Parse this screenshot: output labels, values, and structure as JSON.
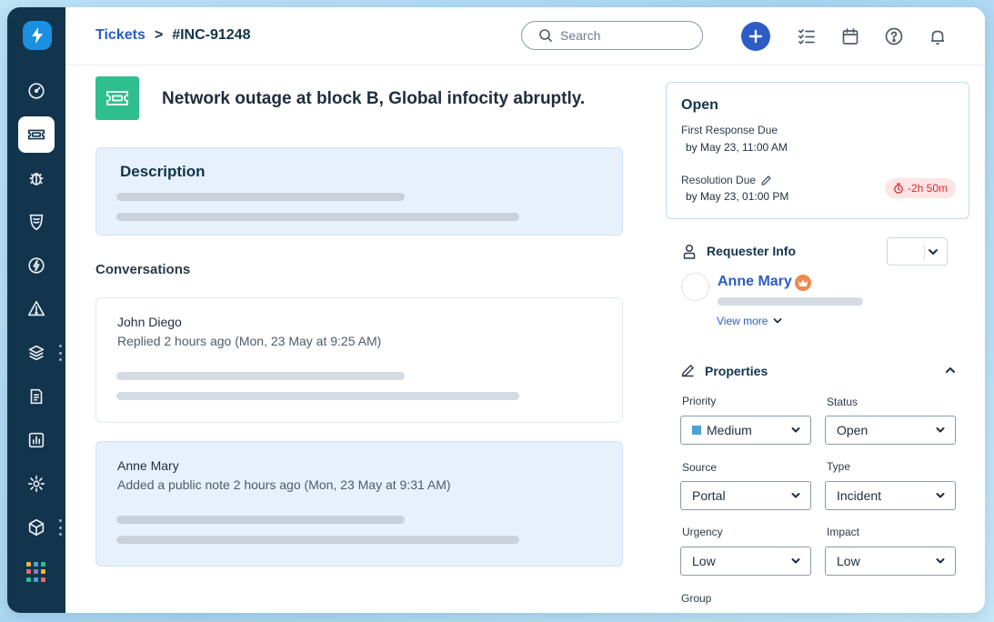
{
  "header": {
    "breadcrumb_link": "Tickets",
    "breadcrumb_sep": ">",
    "ticket_id": "#INC-91248",
    "search_placeholder": "Search"
  },
  "ticket": {
    "title": "Network outage at block B, Global infocity abruptly."
  },
  "description": {
    "heading": "Description"
  },
  "conversations": {
    "heading": "Conversations",
    "items": [
      {
        "name": "John Diego",
        "meta": "Replied 2 hours ago (Mon, 23 May at 9:25 AM)"
      },
      {
        "name": "Anne Mary",
        "meta": "Added a public note 2 hours ago (Mon, 23 May at 9:31 AM)"
      }
    ]
  },
  "status_card": {
    "status": "Open",
    "first_response_label": "First Response Due",
    "first_response_value": "by May 23, 11:00 AM",
    "resolution_label": "Resolution Due",
    "resolution_value": "by May 23, 01:00 PM",
    "overdue": "-2h 50m"
  },
  "requester": {
    "heading": "Requester Info",
    "name": "Anne Mary",
    "view_more": "View more"
  },
  "properties": {
    "heading": "Properties",
    "priority_label": "Priority",
    "priority_value": "Medium",
    "status_label": "Status",
    "status_value": "Open",
    "source_label": "Source",
    "source_value": "Portal",
    "type_label": "Type",
    "type_value": "Incident",
    "urgency_label": "Urgency",
    "urgency_value": "Low",
    "impact_label": "Impact",
    "impact_value": "Low",
    "group_label": "Group"
  },
  "colors": {
    "sidebar": "#12344d",
    "accent": "#2c5cc5",
    "ticket_icon": "#2fbf8f",
    "note_bg": "#e6f1fb",
    "overdue": "#d72d30",
    "priority_medium": "#4da1d6"
  },
  "sidebar_icons": [
    "dashboard-icon",
    "tickets-icon",
    "problems-icon",
    "changes-icon",
    "releases-icon",
    "alerts-icon",
    "assets-icon",
    "solutions-icon",
    "reports-icon",
    "settings-icon",
    "cmdb-icon",
    "apps-grid-icon"
  ]
}
